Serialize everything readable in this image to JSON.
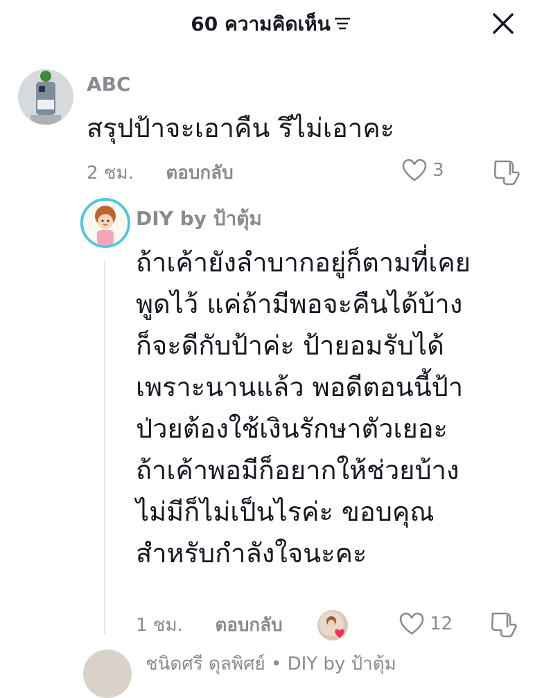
{
  "header": {
    "title": "60 ความคิดเห็น",
    "sort_icon": "sort-lines-icon",
    "close_icon": "close-x-icon"
  },
  "comments": [
    {
      "user": "ABC",
      "text_lines": [
        "สรุปป้าจะเอาคืน รึไม่เอาคะ"
      ],
      "time": "2 ชม.",
      "reply_label": "ตอบกลับ",
      "likes": "3"
    }
  ],
  "reply": {
    "user": "DIY by ป้าตุ้ม",
    "text_lines": [
      "ถ้าเค้ายังลำบากอยู่ก็ตามที่เคย",
      "พูดไว้ แค่ถ้ามีพอจะคืนได้บ้าง",
      "ก็จะดีกับป้าค่ะ ป้ายอมรับได้",
      "เพราะนานแล้ว พอดีตอนนี้ป้า",
      "ป่วยต้องใช้เงินรักษาตัวเยอะ",
      "ถ้าเค้าพอมีก็อยากให้ช่วยบ้าง",
      "ไม่มีก็ไม่เป็นไรค่ะ ขอบคุณ",
      "สำหรับกำลังใจนะคะ"
    ],
    "time": "1 ชม.",
    "reply_label": "ตอบกลับ",
    "likes": "12"
  },
  "next_comment_partial": "ชนิดศรี ดุลพิศย์ • DIY by ป้าตุ้ม"
}
